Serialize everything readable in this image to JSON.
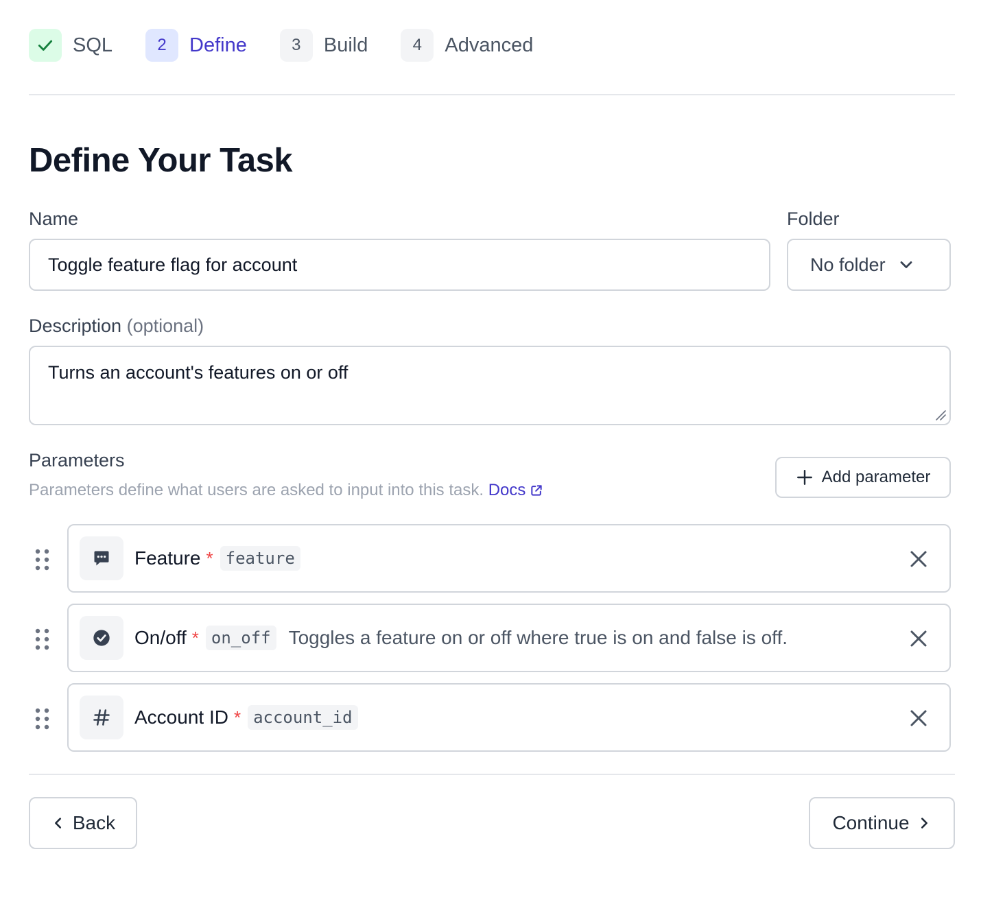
{
  "stepper": {
    "steps": [
      {
        "label": "SQL",
        "badge": "",
        "state": "done"
      },
      {
        "label": "Define",
        "badge": "2",
        "state": "active"
      },
      {
        "label": "Build",
        "badge": "3",
        "state": "todo"
      },
      {
        "label": "Advanced",
        "badge": "4",
        "state": "todo"
      }
    ]
  },
  "page": {
    "title": "Define Your Task"
  },
  "form": {
    "name_label": "Name",
    "name_value": "Toggle feature flag for account",
    "folder_label": "Folder",
    "folder_value": "No folder",
    "description_label": "Description",
    "description_optional": "(optional)",
    "description_value": "Turns an account's features on or off"
  },
  "parameters": {
    "title": "Parameters",
    "help_text": "Parameters define what users are asked to input into this task.",
    "docs_label": "Docs",
    "add_label": "Add parameter",
    "items": [
      {
        "name": "Feature",
        "required_mark": "*",
        "key": "feature",
        "description": "",
        "icon": "chat-bubble-icon"
      },
      {
        "name": "On/off",
        "required_mark": "*",
        "key": "on_off",
        "description": "Toggles a feature on or off where true is on and false is off.",
        "icon": "check-circle-icon"
      },
      {
        "name": "Account ID",
        "required_mark": "*",
        "key": "account_id",
        "description": "",
        "icon": "hash-icon"
      }
    ]
  },
  "footer": {
    "back_label": "Back",
    "continue_label": "Continue"
  },
  "colors": {
    "accent": "#4338ca",
    "success": "#16a34a",
    "required": "#ef4444",
    "border": "#d1d5db"
  }
}
